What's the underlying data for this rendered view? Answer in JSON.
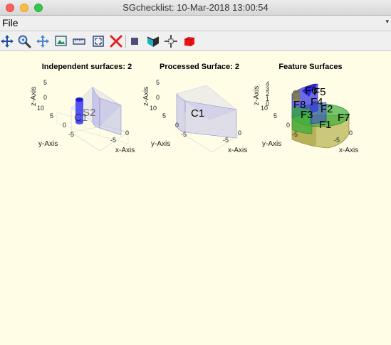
{
  "window": {
    "title": "SGchecklist: 10-Mar-2018 13:00:54"
  },
  "menubar": {
    "file": "File",
    "overflow_arrow": "▾"
  },
  "toolbar": {
    "icons": [
      "rotate-3d-icon",
      "zoom-icon",
      "pan-icon",
      "export-image-icon",
      "ruler-icon",
      "fit-view-icon",
      "delete-icon",
      "square-icon",
      "colormap-icon",
      "crosshair-icon",
      "solid-cube-icon"
    ]
  },
  "plots": [
    {
      "title": "Independent surfaces: 2",
      "labels": [
        "S2",
        "C1"
      ],
      "z_label": "z-Axis",
      "y_label": "y-Axis",
      "x_label": "x-Axis",
      "z_ticks": [
        "5",
        "0"
      ],
      "y_ticks": [
        "10",
        "5",
        "0",
        "-5"
      ],
      "x_ticks": [
        "-5",
        "0"
      ]
    },
    {
      "title": "Processed Surface: 2",
      "labels": [
        "C1"
      ],
      "z_label": "z-Axis",
      "y_label": "y-Axis",
      "x_label": "x-Axis",
      "z_ticks": [
        "5",
        "0"
      ],
      "y_ticks": [
        "10",
        "5",
        "0",
        "-5"
      ],
      "x_ticks": [
        "-5",
        "0"
      ]
    },
    {
      "title": "Feature Surfaces",
      "labels": [
        "F6",
        "F5",
        "F8",
        "F4",
        "F2",
        "F3",
        "F7",
        "F1"
      ],
      "z_label": "z-Axis",
      "y_label": "y-Axis",
      "x_label": "x-Axis",
      "z_ticks": [
        "4",
        "3",
        "2",
        "1",
        "0"
      ],
      "y_ticks": [
        "10",
        "5",
        "0",
        "-5"
      ],
      "x_ticks": [
        "-5",
        "0"
      ]
    }
  ],
  "colors": {
    "figure_bg": "#fffde6",
    "surface": "#9b9bea",
    "cylinder": "#2c2cf0",
    "feature_green": "#3cae3c",
    "feature_yellow": "#b7b04a",
    "feature_blue": "#3a3ae8"
  }
}
